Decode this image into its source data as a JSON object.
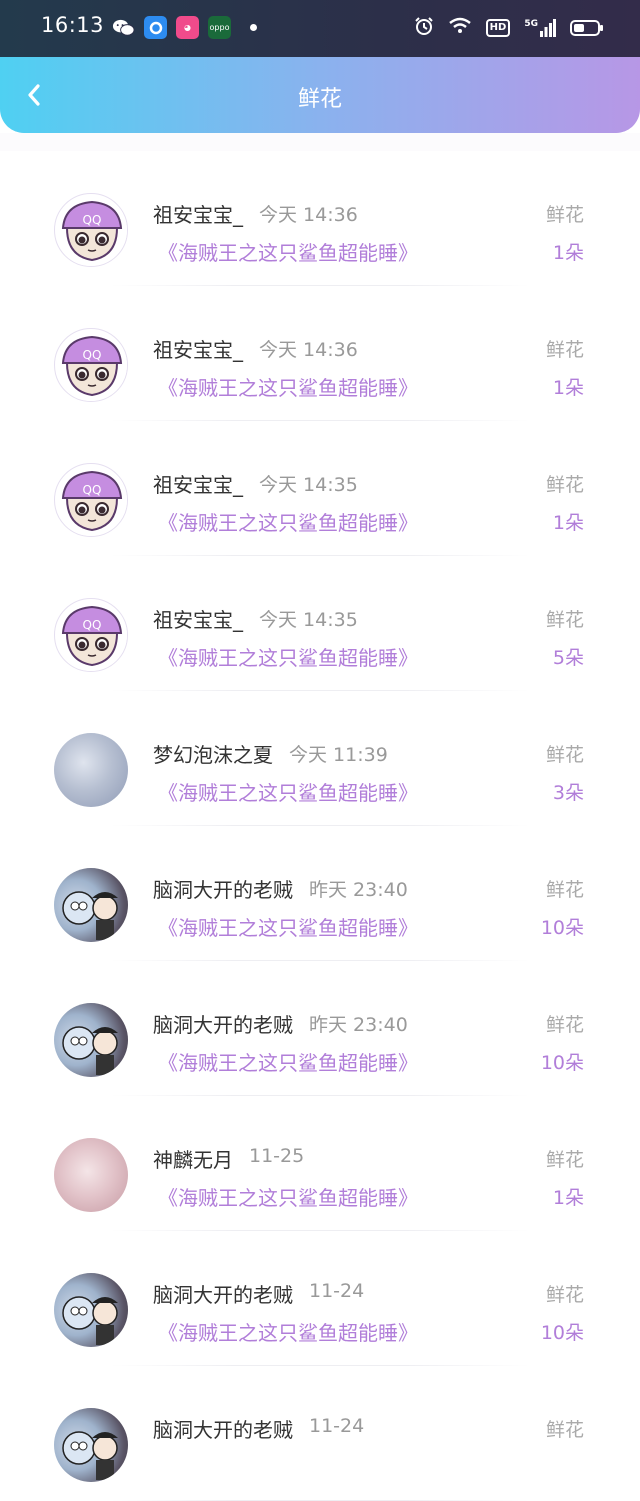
{
  "status_bar": {
    "time": "16:13",
    "battery_level": 0.45,
    "badges": {
      "hd": "HD",
      "network": "5G"
    }
  },
  "header": {
    "title": "鲜花"
  },
  "colors": {
    "accent": "#b17ed9",
    "header_start": "#4fd0f2",
    "header_end": "#b797e6"
  },
  "records": [
    {
      "avatar": "qq-candy-avatar",
      "name": "祖安宝宝_",
      "time": "今天 14:36",
      "work": "《海贼王之这只鲨鱼超能睡》",
      "gift": "鲜花",
      "count": "1朵"
    },
    {
      "avatar": "qq-candy-avatar",
      "name": "祖安宝宝_",
      "time": "今天 14:36",
      "work": "《海贼王之这只鲨鱼超能睡》",
      "gift": "鲜花",
      "count": "1朵"
    },
    {
      "avatar": "qq-candy-avatar",
      "name": "祖安宝宝_",
      "time": "今天 14:35",
      "work": "《海贼王之这只鲨鱼超能睡》",
      "gift": "鲜花",
      "count": "1朵"
    },
    {
      "avatar": "qq-candy-avatar",
      "name": "祖安宝宝_",
      "time": "今天 14:35",
      "work": "《海贼王之这只鲨鱼超能睡》",
      "gift": "鲜花",
      "count": "5朵"
    },
    {
      "avatar": "dreamy-avatar",
      "name": "梦幻泡沫之夏",
      "time": "今天 11:39",
      "work": "《海贼王之这只鲨鱼超能睡》",
      "gift": "鲜花",
      "count": "3朵"
    },
    {
      "avatar": "comic-avatar",
      "name": "脑洞大开的老贼",
      "time": "昨天 23:40",
      "work": "《海贼王之这只鲨鱼超能睡》",
      "gift": "鲜花",
      "count": "10朵"
    },
    {
      "avatar": "comic-avatar",
      "name": "脑洞大开的老贼",
      "time": "昨天 23:40",
      "work": "《海贼王之这只鲨鱼超能睡》",
      "gift": "鲜花",
      "count": "10朵"
    },
    {
      "avatar": "pink-avatar",
      "name": "神麟无月",
      "time": "11-25",
      "work": "《海贼王之这只鲨鱼超能睡》",
      "gift": "鲜花",
      "count": "1朵"
    },
    {
      "avatar": "comic-avatar",
      "name": "脑洞大开的老贼",
      "time": "11-24",
      "work": "《海贼王之这只鲨鱼超能睡》",
      "gift": "鲜花",
      "count": "10朵"
    },
    {
      "avatar": "comic-avatar",
      "name": "脑洞大开的老贼",
      "time": "11-24",
      "work": "",
      "gift": "鲜花",
      "count": ""
    }
  ]
}
